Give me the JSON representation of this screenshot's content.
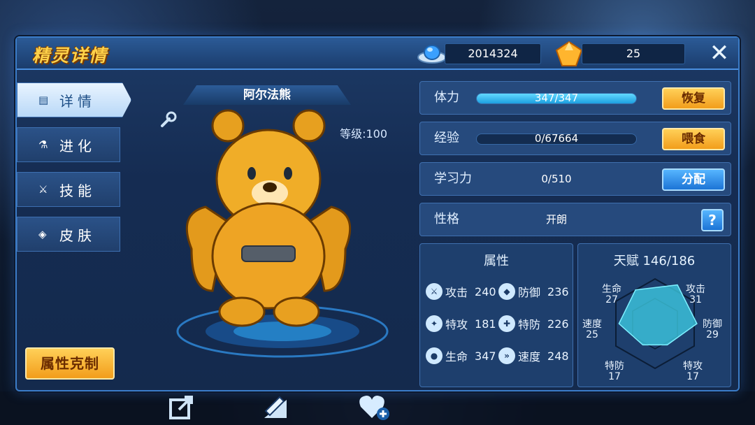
{
  "header": {
    "title": "精灵详情",
    "coins": "2014324",
    "gems": "25"
  },
  "tabs": [
    {
      "icon": "detail-icon",
      "label": "详情"
    },
    {
      "icon": "flask-icon",
      "label": "进化"
    },
    {
      "icon": "sword-icon",
      "label": "技能"
    },
    {
      "icon": "drop-icon",
      "label": "皮肤"
    }
  ],
  "counter_button": "属性克制",
  "pet": {
    "name": "阿尔法熊",
    "level": "等级:100"
  },
  "stamina": {
    "label": "体力",
    "value": "347/347",
    "fill": 1.0,
    "button": "恢复"
  },
  "exp": {
    "label": "经验",
    "value": "0/67664",
    "fill": 0.0,
    "button": "喂食"
  },
  "learning": {
    "label": "学习力",
    "value": "0/510",
    "button": "分配"
  },
  "nature": {
    "label": "性格",
    "value": "开朗",
    "help": "?"
  },
  "attributes": {
    "title": "属性",
    "stats": [
      {
        "name": "攻击",
        "value": "240"
      },
      {
        "name": "防御",
        "value": "236"
      },
      {
        "name": "特攻",
        "value": "181"
      },
      {
        "name": "特防",
        "value": "226"
      },
      {
        "name": "生命",
        "value": "347"
      },
      {
        "name": "速度",
        "value": "248"
      }
    ]
  },
  "talent": {
    "title": "天赋 146/186",
    "axes": [
      {
        "name": "生命",
        "value": "27"
      },
      {
        "name": "攻击",
        "value": "31"
      },
      {
        "name": "防御",
        "value": "29"
      },
      {
        "name": "特攻",
        "value": "17"
      },
      {
        "name": "特防",
        "value": "17"
      },
      {
        "name": "速度",
        "value": "25"
      }
    ]
  },
  "colors": {
    "accent": "#ffd24a",
    "panel": "#1d3a66",
    "radar": "#3fd1e8"
  }
}
